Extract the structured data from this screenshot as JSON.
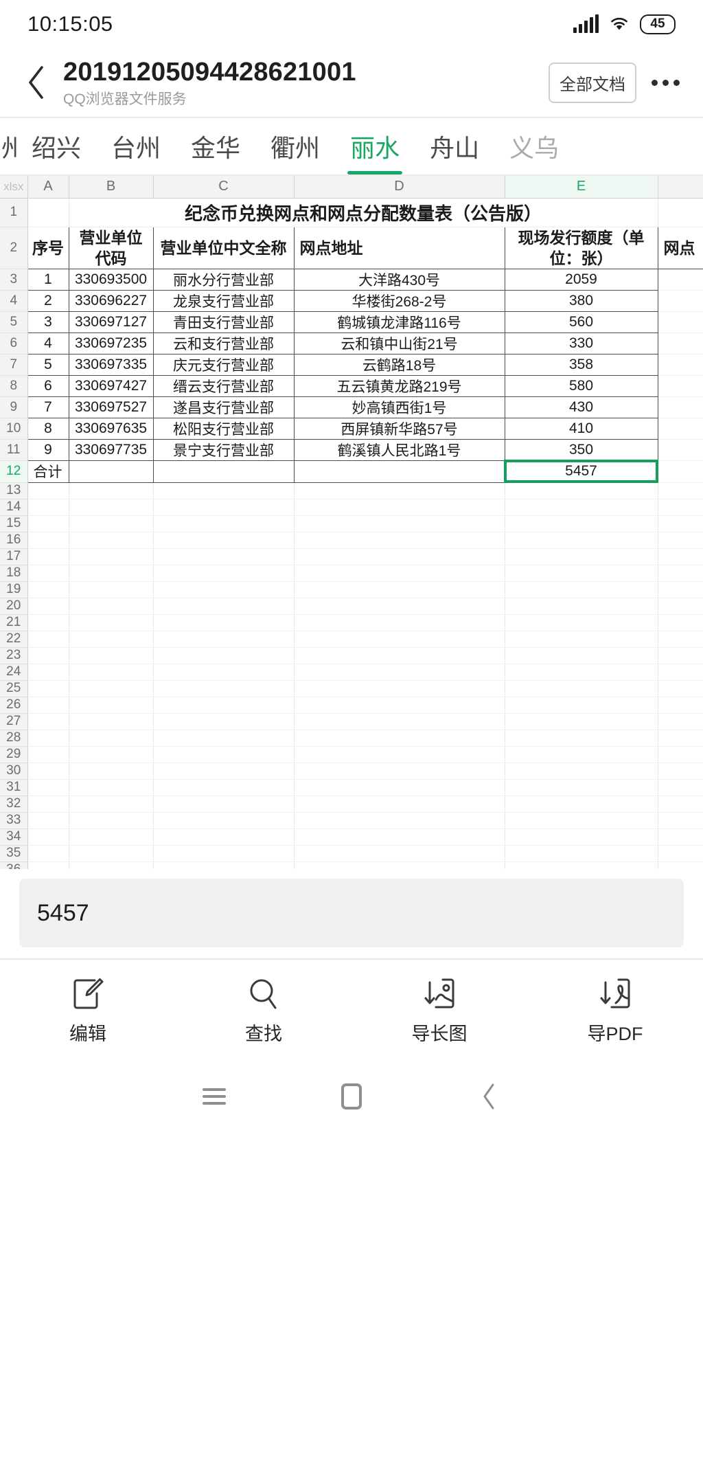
{
  "status_bar": {
    "time": "10:15:05",
    "signal_icon": "cellular-signal-icon",
    "wifi_icon": "wifi-icon",
    "battery_level": "45"
  },
  "header": {
    "back_icon": "back-chevron-icon",
    "title": "20191205094428621001",
    "subtitle": "QQ浏览器文件服务",
    "all_files_label": "全部文档",
    "more_icon": "more-options-icon"
  },
  "sheet_tabs": {
    "items": [
      {
        "label": "绍兴",
        "active": false,
        "dim": false
      },
      {
        "label": "台州",
        "active": false,
        "dim": false
      },
      {
        "label": "金华",
        "active": false,
        "dim": false
      },
      {
        "label": "衢州",
        "active": false,
        "dim": false
      },
      {
        "label": "丽水",
        "active": true,
        "dim": false
      },
      {
        "label": "舟山",
        "active": false,
        "dim": false
      },
      {
        "label": "义乌",
        "active": false,
        "dim": true
      }
    ],
    "active_color": "#16a868"
  },
  "spreadsheet": {
    "corner_label": "xlsx",
    "column_headers": [
      "A",
      "B",
      "C",
      "D",
      "E",
      ""
    ],
    "active_column": "E",
    "active_row": "12",
    "doc_title": "纪念币兑换网点和网点分配数量表（公告版）",
    "table_headers": [
      "序号",
      "营业单位代码",
      "营业单位中文全称",
      "网点地址",
      "现场发行额度（单位：张）",
      "网点"
    ],
    "rows": [
      {
        "row": "3",
        "seq": "1",
        "code": "330693500",
        "name": "丽水分行营业部",
        "address": "大洋路430号",
        "quota": "2059"
      },
      {
        "row": "4",
        "seq": "2",
        "code": "330696227",
        "name": "龙泉支行营业部",
        "address": "华楼街268-2号",
        "quota": "380"
      },
      {
        "row": "5",
        "seq": "3",
        "code": "330697127",
        "name": "青田支行营业部",
        "address": "鹤城镇龙津路116号",
        "quota": "560"
      },
      {
        "row": "6",
        "seq": "4",
        "code": "330697235",
        "name": "云和支行营业部",
        "address": "云和镇中山街21号",
        "quota": "330"
      },
      {
        "row": "7",
        "seq": "5",
        "code": "330697335",
        "name": "庆元支行营业部",
        "address": "云鹤路18号",
        "quota": "358"
      },
      {
        "row": "8",
        "seq": "6",
        "code": "330697427",
        "name": "缙云支行营业部",
        "address": "五云镇黄龙路219号",
        "quota": "580"
      },
      {
        "row": "9",
        "seq": "7",
        "code": "330697527",
        "name": "遂昌支行营业部",
        "address": "妙高镇西街1号",
        "quota": "430"
      },
      {
        "row": "10",
        "seq": "8",
        "code": "330697635",
        "name": "松阳支行营业部",
        "address": "西屏镇新华路57号",
        "quota": "410"
      },
      {
        "row": "11",
        "seq": "9",
        "code": "330697735",
        "name": "景宁支行营业部",
        "address": "鹤溪镇人民北路1号",
        "quota": "350"
      }
    ],
    "total_row": {
      "row": "12",
      "label": "合计",
      "quota": "5457"
    },
    "selected_cell_value": "5457",
    "selection_color": "#13a05f",
    "empty_row_start": 13,
    "empty_row_end": 53
  },
  "formula_bar": {
    "value": "5457"
  },
  "toolbar": {
    "items": [
      {
        "label": "编辑",
        "icon": "edit-pencil-icon"
      },
      {
        "label": "查找",
        "icon": "search-icon"
      },
      {
        "label": "导长图",
        "icon": "export-long-image-icon"
      },
      {
        "label": "导PDF",
        "icon": "export-pdf-icon"
      }
    ]
  },
  "nav_bar": {
    "recents_icon": "menu-recents-icon",
    "home_icon": "home-icon",
    "back_icon": "back-chevron-icon"
  }
}
